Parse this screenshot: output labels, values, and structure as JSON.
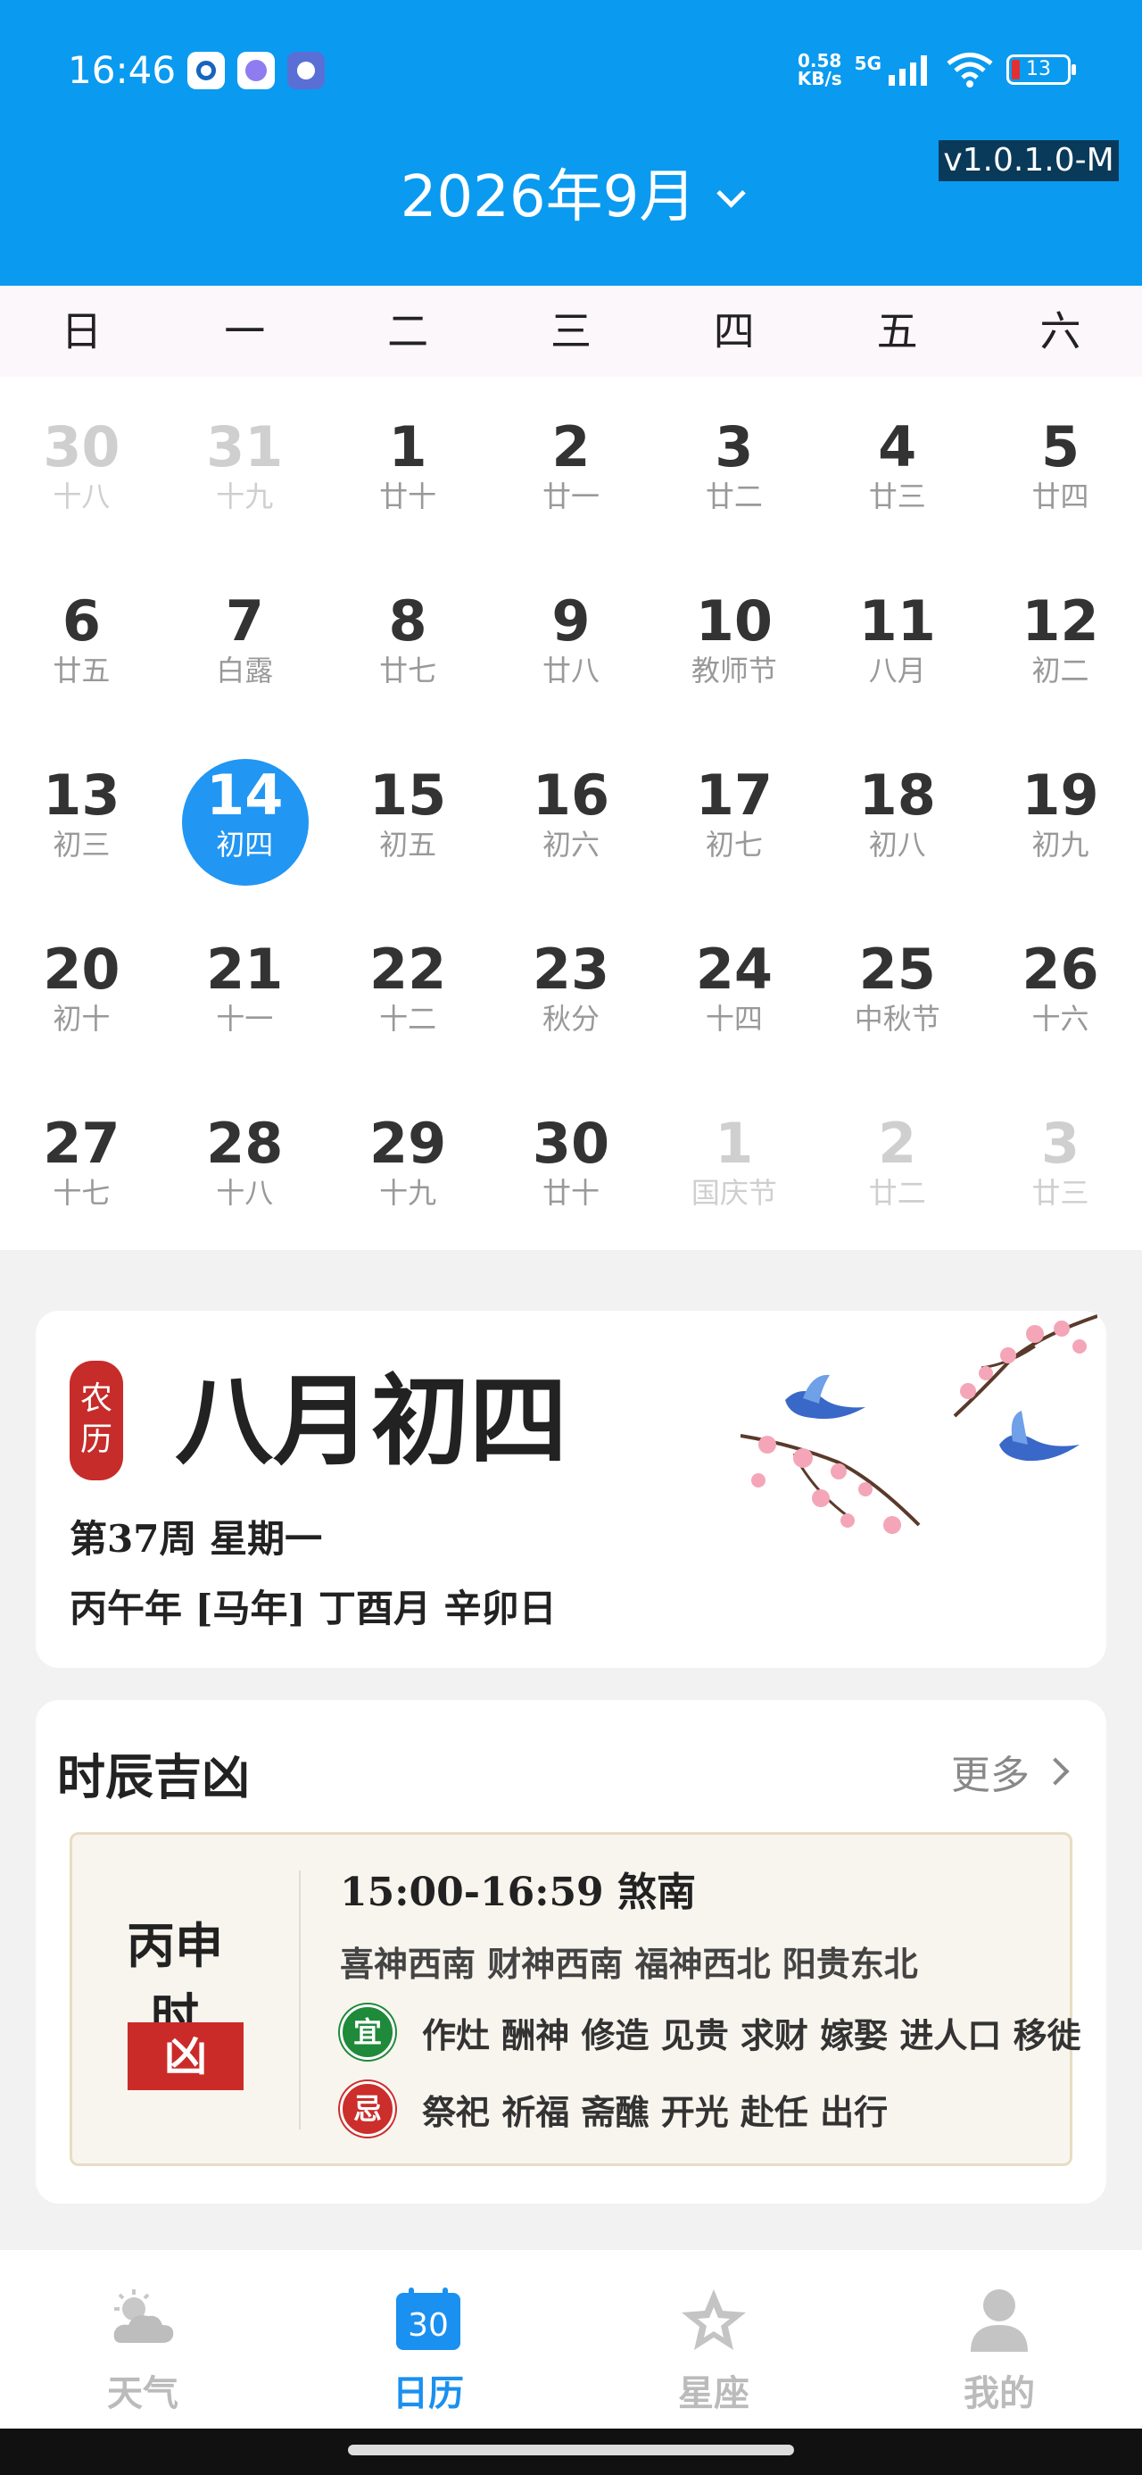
{
  "status_bar": {
    "time": "16:46",
    "net_speed_value": "0.58",
    "net_speed_unit": "KB/s",
    "network": "5G",
    "battery": "13"
  },
  "header": {
    "title": "2026年9月",
    "version": "v1.0.1.0-M"
  },
  "weekdays": [
    "日",
    "一",
    "二",
    "三",
    "四",
    "五",
    "六"
  ],
  "calendar": {
    "weeks": [
      [
        {
          "day": "30",
          "lunar": "十八",
          "other": true
        },
        {
          "day": "31",
          "lunar": "十九",
          "other": true
        },
        {
          "day": "1",
          "lunar": "廿十"
        },
        {
          "day": "2",
          "lunar": "廿一"
        },
        {
          "day": "3",
          "lunar": "廿二"
        },
        {
          "day": "4",
          "lunar": "廿三"
        },
        {
          "day": "5",
          "lunar": "廿四"
        }
      ],
      [
        {
          "day": "6",
          "lunar": "廿五"
        },
        {
          "day": "7",
          "lunar": "白露"
        },
        {
          "day": "8",
          "lunar": "廿七"
        },
        {
          "day": "9",
          "lunar": "廿八"
        },
        {
          "day": "10",
          "lunar": "教师节"
        },
        {
          "day": "11",
          "lunar": "八月"
        },
        {
          "day": "12",
          "lunar": "初二"
        }
      ],
      [
        {
          "day": "13",
          "lunar": "初三"
        },
        {
          "day": "14",
          "lunar": "初四",
          "selected": true
        },
        {
          "day": "15",
          "lunar": "初五"
        },
        {
          "day": "16",
          "lunar": "初六"
        },
        {
          "day": "17",
          "lunar": "初七"
        },
        {
          "day": "18",
          "lunar": "初八"
        },
        {
          "day": "19",
          "lunar": "初九"
        }
      ],
      [
        {
          "day": "20",
          "lunar": "初十"
        },
        {
          "day": "21",
          "lunar": "十一"
        },
        {
          "day": "22",
          "lunar": "十二"
        },
        {
          "day": "23",
          "lunar": "秋分"
        },
        {
          "day": "24",
          "lunar": "十四"
        },
        {
          "day": "25",
          "lunar": "中秋节"
        },
        {
          "day": "26",
          "lunar": "十六"
        }
      ],
      [
        {
          "day": "27",
          "lunar": "十七"
        },
        {
          "day": "28",
          "lunar": "十八"
        },
        {
          "day": "29",
          "lunar": "十九"
        },
        {
          "day": "30",
          "lunar": "廿十"
        },
        {
          "day": "1",
          "lunar": "国庆节",
          "other": true
        },
        {
          "day": "2",
          "lunar": "廿二",
          "other": true
        },
        {
          "day": "3",
          "lunar": "廿三",
          "other": true
        }
      ]
    ]
  },
  "lunar_card": {
    "seal_top": "农",
    "seal_bottom": "历",
    "title": "八月初四",
    "week_line": "第37周 星期一",
    "ganzhi_line": "丙午年 [马年] 丁酉月 辛卯日"
  },
  "hours_card": {
    "title": "时辰吉凶",
    "more": "更多",
    "hour_name": "丙申时",
    "verdict": "凶",
    "time_line": "15:00-16:59 煞南",
    "gods_line": "喜神西南 财神西南 福神西北 阳贵东北",
    "yi_label": "宜",
    "yi_text": "作灶 酬神 修造 见贵 求财 嫁娶 进人口 移徙",
    "ji_label": "忌",
    "ji_text": "祭祀 祈福 斋醮 开光 赴任 出行"
  },
  "tabbar": {
    "tabs": [
      {
        "label": "天气",
        "icon": "weather-icon"
      },
      {
        "label": "日历",
        "icon": "calendar-icon",
        "active": true,
        "icon_text": "30"
      },
      {
        "label": "星座",
        "icon": "star-icon"
      },
      {
        "label": "我的",
        "icon": "profile-icon"
      }
    ]
  },
  "colors": {
    "header_bg": "#0a9af0",
    "selected_day": "#2196f3",
    "active_tab": "#1a90f0",
    "xiong_red": "#cb2b28",
    "yi_green": "#1e8a3a"
  }
}
